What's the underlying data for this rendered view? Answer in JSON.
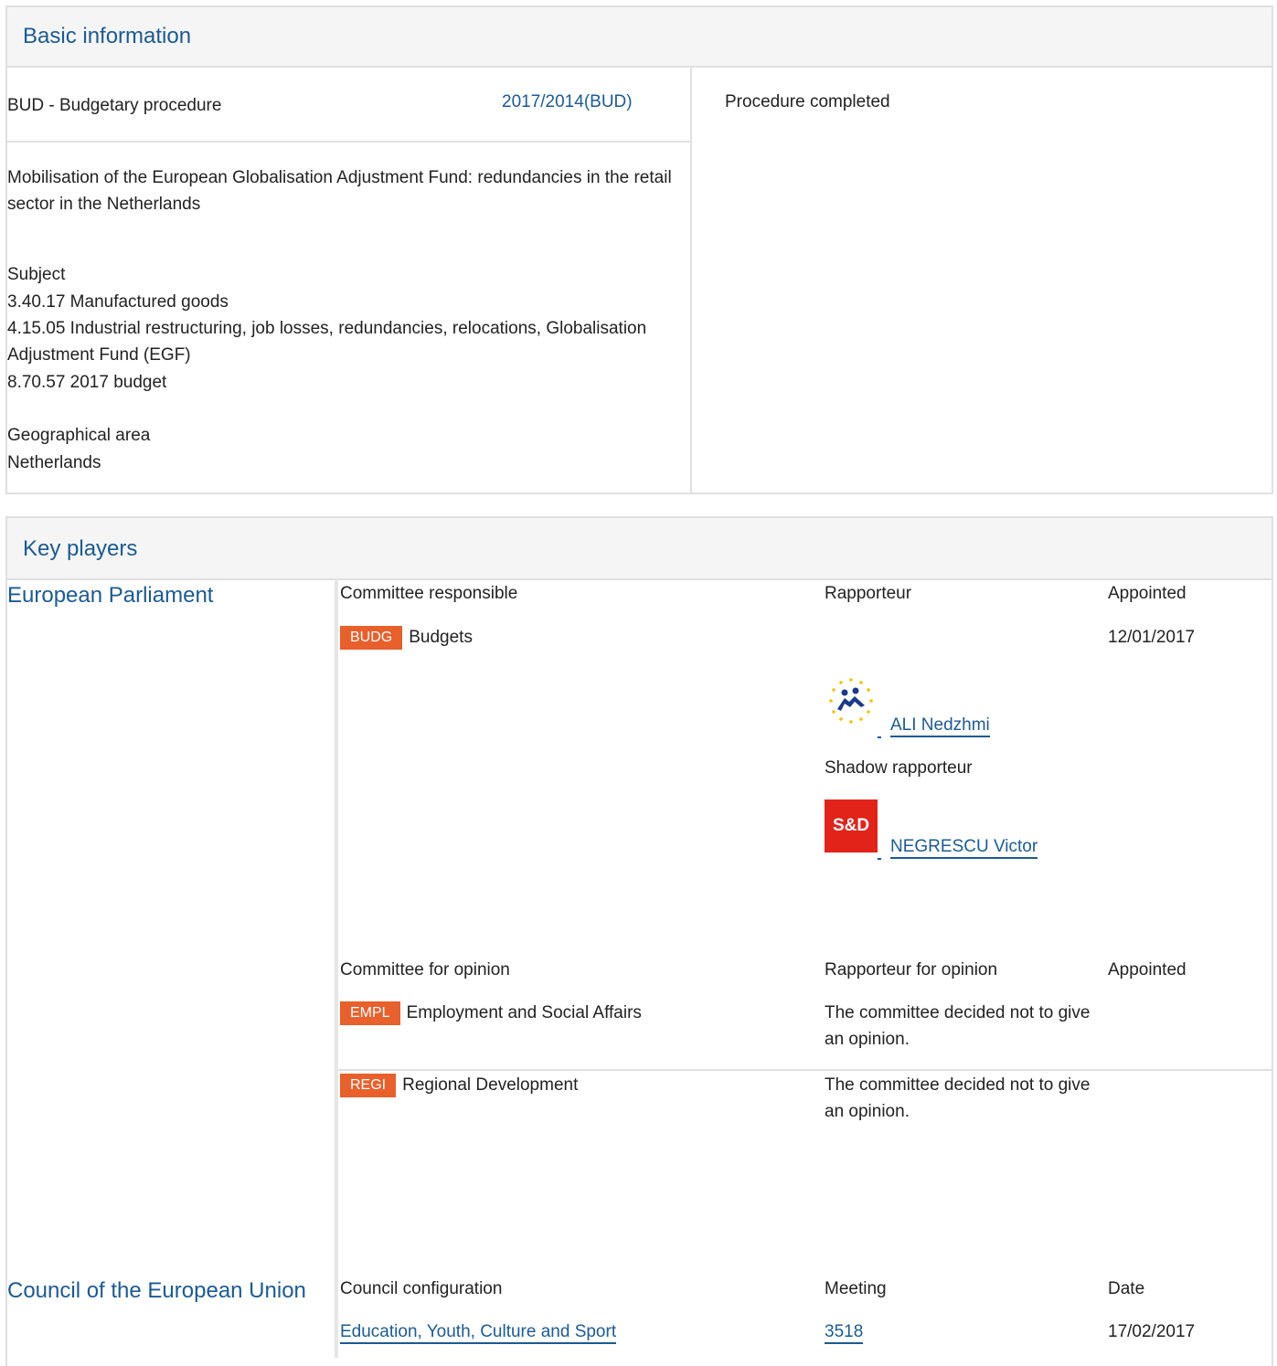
{
  "basic": {
    "title": "Basic information",
    "procedure_type": "BUD - Budgetary procedure",
    "reference": "2017/2014(BUD)",
    "status": "Procedure completed",
    "description": "Mobilisation of the European Globalisation Adjustment Fund: redundancies in the retail sector in the Netherlands",
    "subject_label": "Subject",
    "subjects": [
      "3.40.17 Manufactured goods",
      "4.15.05 Industrial restructuring, job losses, redundancies, relocations, Globalisation Adjustment Fund (EGF)",
      "8.70.57 2017 budget"
    ],
    "geo_label": "Geographical area",
    "geo_value": "Netherlands"
  },
  "players": {
    "title": "Key players",
    "ep": {
      "name": "European Parliament",
      "responsible_header": "Committee responsible",
      "rapporteur_header": "Rapporteur",
      "appointed_header": "Appointed",
      "responsible": {
        "code": "BUDG",
        "name": "Budgets",
        "appointed": "12/01/2017",
        "rapporteur_logo_name": "alde-group-logo",
        "rapporteur": "ALI Nedzhmi",
        "shadow_label": "Shadow rapporteur",
        "shadow_logo_text": "S&D",
        "shadow": "NEGRESCU Victor"
      },
      "opinion_header": "Committee for opinion",
      "opinion_rapporteur_header": "Rapporteur for opinion",
      "opinion_appointed_header": "Appointed",
      "opinions": [
        {
          "code": "EMPL",
          "name": "Employment and Social Affairs",
          "note": "The committee decided not to give an opinion."
        },
        {
          "code": "REGI",
          "name": "Regional Development",
          "note": "The committee decided not to give an opinion."
        }
      ]
    },
    "council": {
      "name": "Council of the European Union",
      "config_header": "Council configuration",
      "meeting_header": "Meeting",
      "date_header": "Date",
      "config": "Education, Youth, Culture and Sport",
      "meeting": "3518",
      "date": "17/02/2017"
    }
  },
  "colors": {
    "accent": "#1c5a94",
    "badge": "#e8602c",
    "sd_red": "#e2231a"
  }
}
